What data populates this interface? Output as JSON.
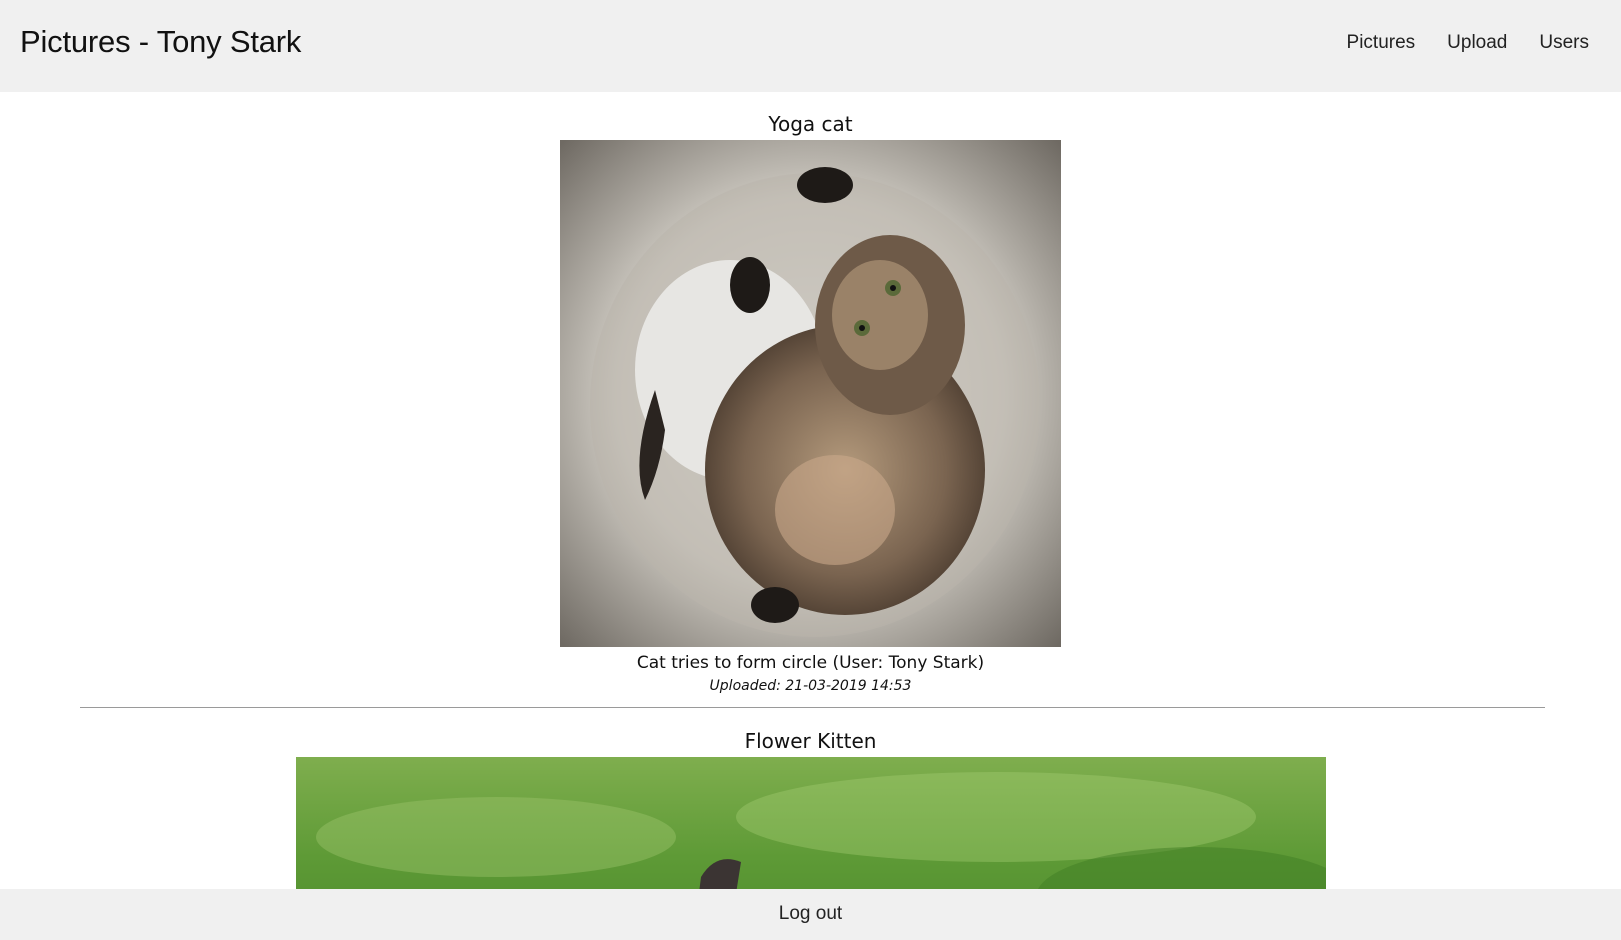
{
  "header": {
    "title": "Pictures - Tony Stark",
    "nav": [
      "Pictures",
      "Upload",
      "Users"
    ]
  },
  "posts": [
    {
      "title": "Yoga cat",
      "caption": "Cat tries to form circle (User: Tony Stark)",
      "uploaded": "Uploaded: 21-03-2019 14:53"
    },
    {
      "title": "Flower Kitten"
    }
  ],
  "footer": {
    "logout": "Log out"
  },
  "colors": {
    "header_bg": "#f0f0f0",
    "divider": "#9a9a9a"
  }
}
